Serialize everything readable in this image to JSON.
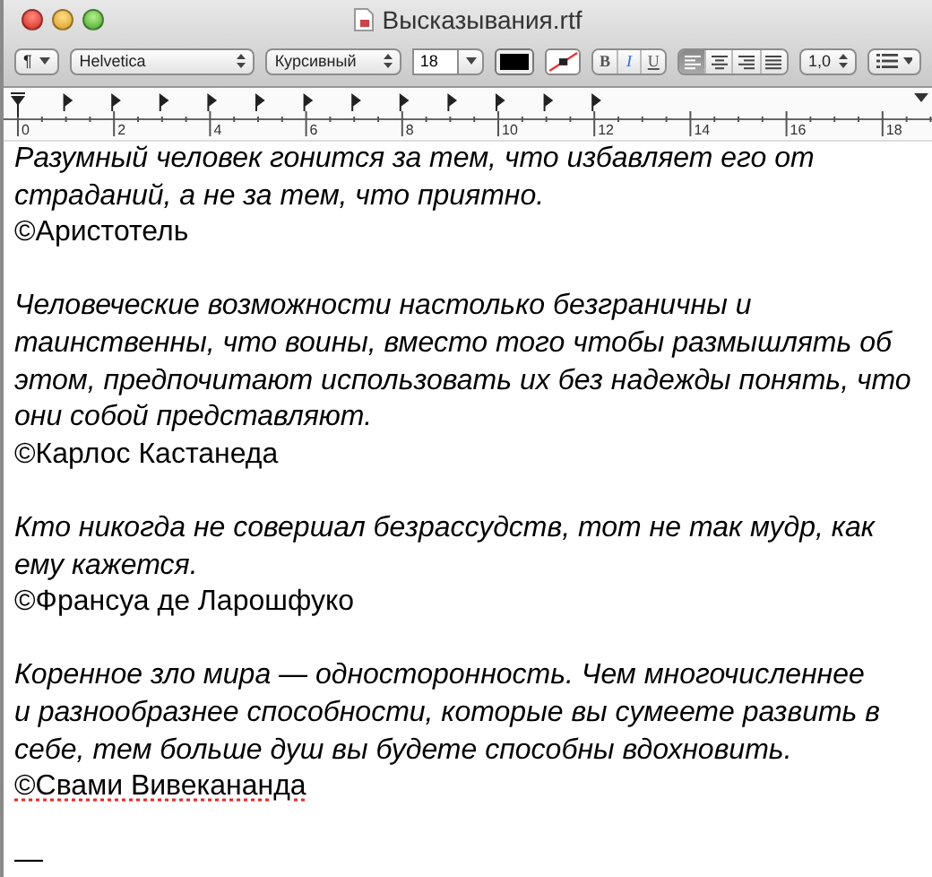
{
  "window": {
    "title": "Высказывания.rtf"
  },
  "toolbar": {
    "paragraph_style": "¶",
    "font": "Helvetica",
    "typeface": "Курсивный",
    "size": "18",
    "styles": [
      {
        "label": "B",
        "selected": false,
        "kind": "bold"
      },
      {
        "label": "I",
        "selected": true,
        "kind": "italic"
      },
      {
        "label": "U",
        "selected": false,
        "kind": "underline"
      }
    ],
    "alignments": [
      {
        "kind": "left",
        "selected": true
      },
      {
        "kind": "center",
        "selected": false
      },
      {
        "kind": "right",
        "selected": false
      },
      {
        "kind": "justify",
        "selected": false
      }
    ],
    "spacing": "1,0"
  },
  "ruler": {
    "labels": [
      "0",
      "2",
      "4",
      "6",
      "8",
      "10",
      "12",
      "14",
      "16",
      "18"
    ]
  },
  "document": [
    {
      "kind": "quote",
      "lines": [
        "Разумный человек гонится за тем, что избавляет его от",
        "страданий, а не за тем, что приятно."
      ]
    },
    {
      "kind": "author",
      "text": "©Аристотель",
      "misspelled": false
    },
    {
      "kind": "blank"
    },
    {
      "kind": "quote",
      "lines": [
        "Человеческие возможности настолько безграничны и",
        "таинственны, что воины, вместо того чтобы размышлять об",
        "этом, предпочитают использовать их без надежды понять, что",
        "они собой представляют."
      ]
    },
    {
      "kind": "author",
      "text": "©Карлос Кастанеда",
      "misspelled": false
    },
    {
      "kind": "blank"
    },
    {
      "kind": "quote",
      "lines": [
        "Кто никогда не совершал безрассудств, тот не так мудр, как",
        "ему кажется."
      ]
    },
    {
      "kind": "author",
      "text": "©Франсуа де Ларошфуко",
      "misspelled": false
    },
    {
      "kind": "blank"
    },
    {
      "kind": "quote",
      "lines": [
        "Коренное зло мира — односторонность. Чем многочисленнее",
        "и разнообразнее способности, которые вы сумеете развить в",
        "себе, тем больше душ вы будете способны вдохновить."
      ]
    },
    {
      "kind": "author",
      "text": "©Свами Вивекананда",
      "misspelled": true
    },
    {
      "kind": "blank"
    },
    {
      "kind": "author",
      "text": "—"
    }
  ]
}
